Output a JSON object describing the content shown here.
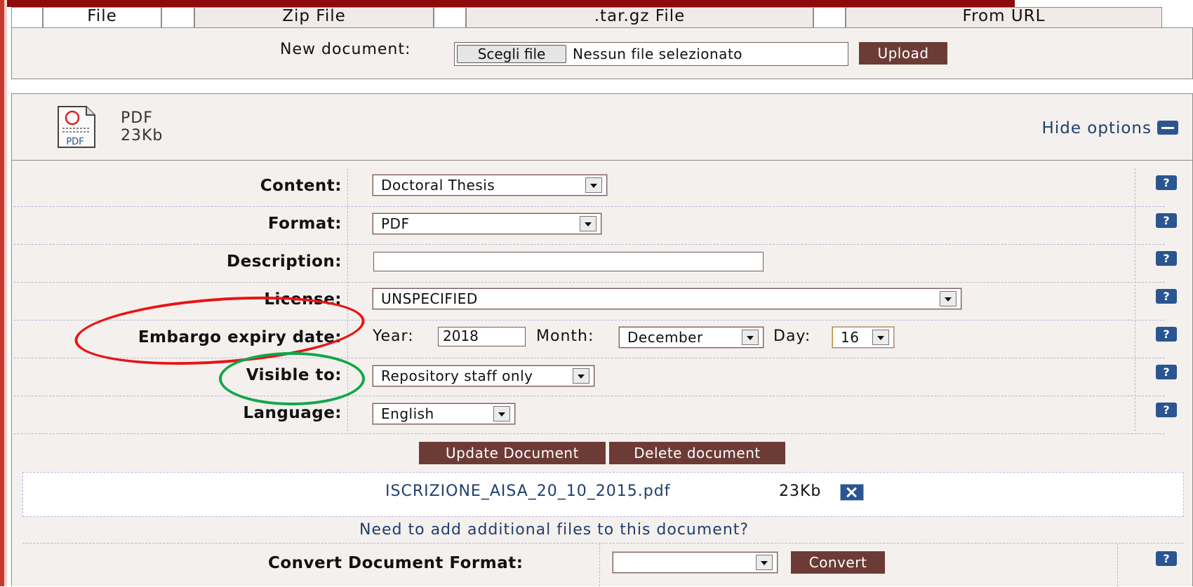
{
  "tabs": [
    {
      "label": "File",
      "active": true
    },
    {
      "label": "Zip File",
      "active": false
    },
    {
      "label": ".tar.gz File",
      "active": false
    },
    {
      "label": "From URL",
      "active": false
    }
  ],
  "upload": {
    "label": "New document:",
    "choose_button": "Scegli file",
    "file_status": "Nessun file selezionato",
    "upload_button": "Upload"
  },
  "document": {
    "icon_text": "PDF",
    "type": "PDF",
    "size": "23Kb",
    "hide_options": "Hide options"
  },
  "fields": {
    "content": {
      "label": "Content:",
      "value": "Doctoral Thesis"
    },
    "format": {
      "label": "Format:",
      "value": "PDF"
    },
    "description": {
      "label": "Description:",
      "value": ""
    },
    "license": {
      "label": "License:",
      "value": "UNSPECIFIED"
    },
    "embargo": {
      "label": "Embargo expiry date:",
      "year_label": "Year:",
      "year": "2018",
      "month_label": "Month:",
      "month": "December",
      "day_label": "Day:",
      "day": "16"
    },
    "visible_to": {
      "label": "Visible to:",
      "value": "Repository staff only"
    },
    "language": {
      "label": "Language:",
      "value": "English"
    }
  },
  "help_icon_text": "?",
  "actions": {
    "update": "Update Document",
    "delete": "Delete document"
  },
  "file": {
    "name": "ISCRIZIONE_AISA_20_10_2015.pdf",
    "size": "23Kb"
  },
  "add_files_link": "Need to add additional files to this document?",
  "convert": {
    "label": "Convert Document Format:",
    "value": "",
    "button": "Convert"
  },
  "colors": {
    "brand_red": "#8f0a0a",
    "button_brown": "#6d3b36",
    "panel_bg": "#f4f0ed",
    "link_blue": "#1f3f6e",
    "icon_blue": "#2a5590",
    "annotation_red": "#e81414",
    "annotation_green": "#12a64a"
  }
}
